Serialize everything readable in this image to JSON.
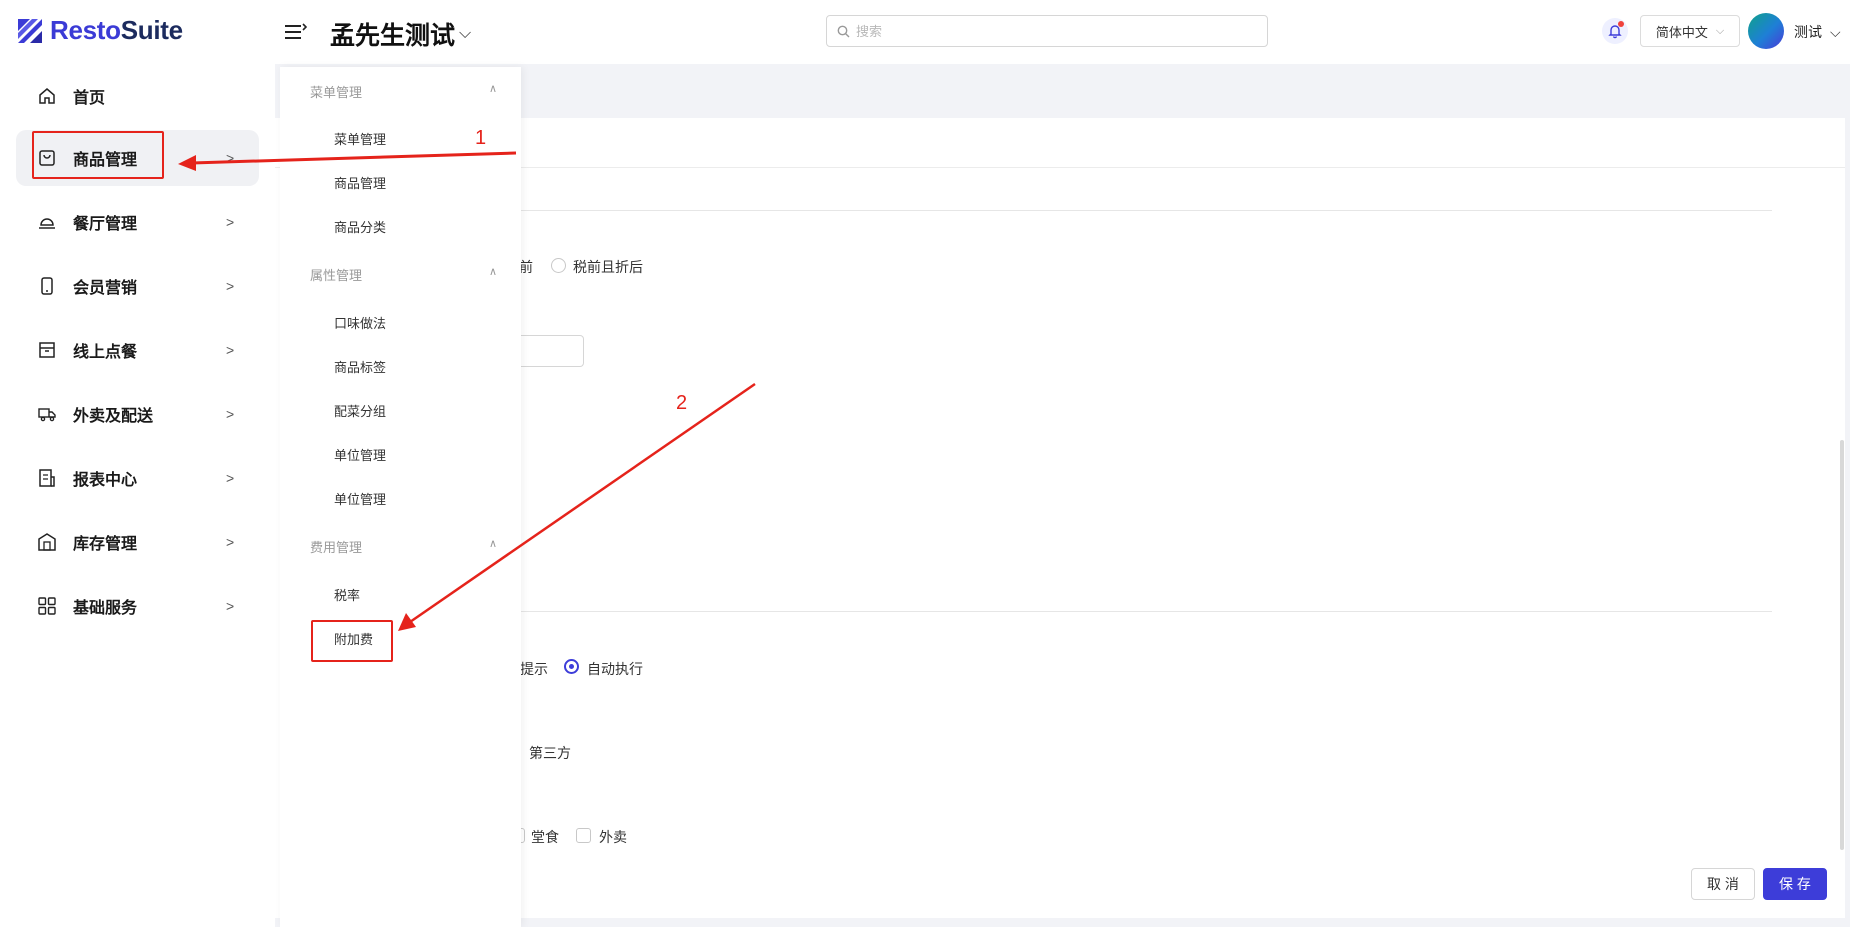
{
  "header": {
    "logo_prefix": "Resto",
    "logo_suffix": "Suite",
    "store_name": "孟先生测试",
    "search_placeholder": "搜索",
    "language": "简体中文",
    "user_name": "测试"
  },
  "sidebar": {
    "items": [
      {
        "label": "首页",
        "icon": "home-icon"
      },
      {
        "label": "商品管理",
        "icon": "bag-icon",
        "active": true
      },
      {
        "label": "餐厅管理",
        "icon": "cloche-icon"
      },
      {
        "label": "会员营销",
        "icon": "phone-icon"
      },
      {
        "label": "线上点餐",
        "icon": "box-icon"
      },
      {
        "label": "外卖及配送",
        "icon": "truck-icon"
      },
      {
        "label": "报表中心",
        "icon": "report-icon"
      },
      {
        "label": "库存管理",
        "icon": "warehouse-icon"
      },
      {
        "label": "基础服务",
        "icon": "grid-icon"
      }
    ]
  },
  "submenu": {
    "groups": [
      {
        "title": "菜单管理",
        "items": [
          "菜单管理",
          "商品管理",
          "商品分类"
        ]
      },
      {
        "title": "属性管理",
        "items": [
          "口味做法",
          "商品标签",
          "配菜分组",
          "单位管理",
          "单位管理"
        ]
      },
      {
        "title": "费用管理",
        "items": [
          "税率",
          "附加费"
        ]
      }
    ]
  },
  "background_form": {
    "tax_option_partial": "前",
    "tax_option": "税前且折后",
    "exec_option_partial": "提示",
    "exec_option": "自动执行",
    "channel_option": "第三方",
    "dine_in_option": "堂食",
    "takeout_option": "外卖"
  },
  "footer": {
    "cancel_label": "取 消",
    "save_label": "保 存"
  },
  "annotations": {
    "step1": "1",
    "step2": "2",
    "color": "#e5231b"
  },
  "colors": {
    "brand": "#3b3bd6",
    "primary_button": "#3d3dd9"
  }
}
